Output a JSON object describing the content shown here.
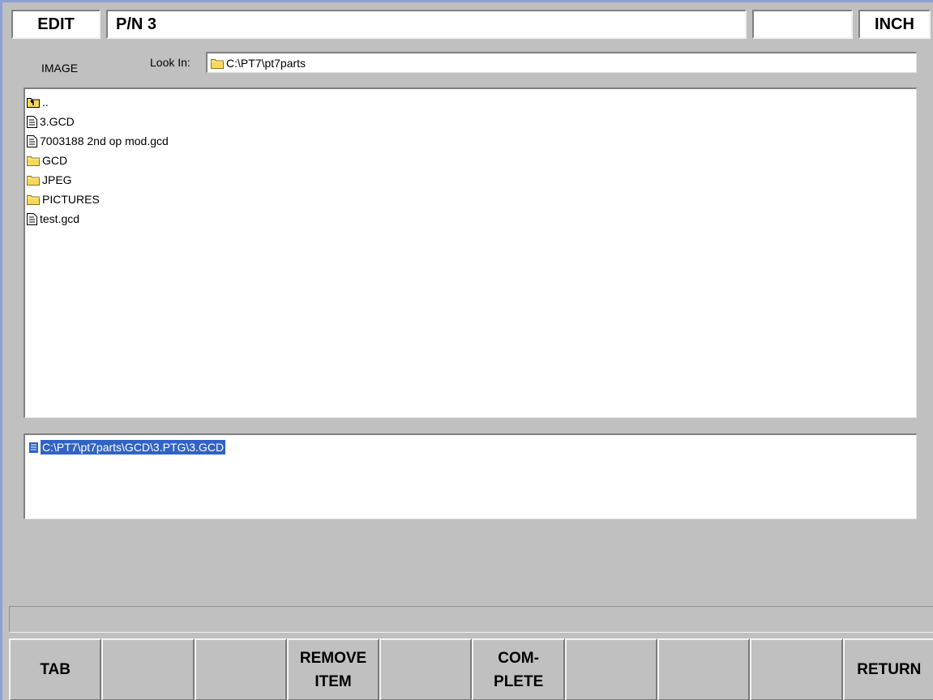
{
  "header": {
    "mode": "EDIT",
    "part_number": "P/N 3",
    "blank": "",
    "units": "INCH"
  },
  "image_label": "IMAGE",
  "look_in": {
    "label": "Look In:",
    "path": "C:\\PT7\\pt7parts",
    "icon": "folder-icon"
  },
  "file_list": [
    {
      "name": "..",
      "icon": "parent-folder-icon"
    },
    {
      "name": "3.GCD",
      "icon": "file-icon"
    },
    {
      "name": "7003188 2nd op mod.gcd",
      "icon": "file-icon"
    },
    {
      "name": "GCD",
      "icon": "folder-icon"
    },
    {
      "name": "JPEG",
      "icon": "folder-icon"
    },
    {
      "name": "PICTURES",
      "icon": "folder-icon"
    },
    {
      "name": "test.gcd",
      "icon": "file-icon"
    }
  ],
  "selected": {
    "path": "C:\\PT7\\pt7parts\\GCD\\3.PTG\\3.GCD",
    "icon": "file-icon",
    "highlight_color": "#3163c5"
  },
  "status_text": "",
  "softkeys": [
    {
      "label": "TAB"
    },
    {
      "label": ""
    },
    {
      "label": ""
    },
    {
      "label": "REMOVE\nITEM"
    },
    {
      "label": ""
    },
    {
      "label": "COM-\nPLETE"
    },
    {
      "label": ""
    },
    {
      "label": ""
    },
    {
      "label": ""
    },
    {
      "label": "RETURN"
    }
  ],
  "colors": {
    "background": "#c0c0c0",
    "frame_accent": "#8f9fd8",
    "selection": "#3163c5"
  }
}
